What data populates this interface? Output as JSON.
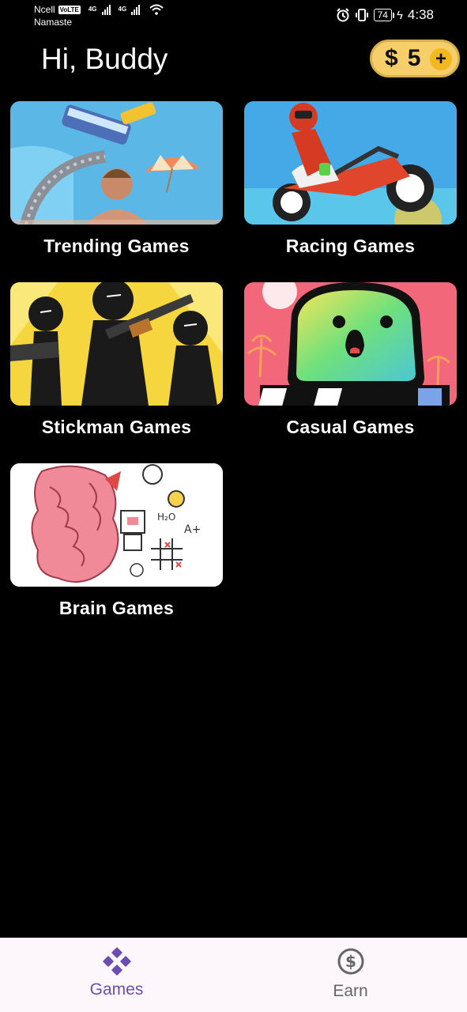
{
  "status_bar": {
    "carrier": "Ncell",
    "volte_badge": "VoLTE",
    "sim2_name": "Namaste",
    "network_1": "4G",
    "network_2": "4G",
    "battery": "74",
    "time": "4:38"
  },
  "header": {
    "greeting": "Hi, Buddy",
    "coin_symbol": "$",
    "coin_count": "5",
    "add_coins_symbol": "+"
  },
  "categories": [
    {
      "label": "Trending Games",
      "icon": "trending-thumbnail"
    },
    {
      "label": "Racing Games",
      "icon": "racing-thumbnail"
    },
    {
      "label": "Stickman Games",
      "icon": "stickman-thumbnail"
    },
    {
      "label": "Casual Games",
      "icon": "casual-thumbnail"
    },
    {
      "label": "Brain Games",
      "icon": "brain-thumbnail"
    }
  ],
  "bottom_nav": {
    "items": [
      {
        "label": "Games",
        "icon": "gamepad-icon",
        "active": true,
        "color": "#6a4fb0"
      },
      {
        "label": "Earn",
        "icon": "dollar-circle-icon",
        "active": false,
        "color": "#666666"
      }
    ]
  },
  "colors": {
    "background": "#000000",
    "coin_pill": "#f7cf6a",
    "nav_background": "#fdf6fb",
    "accent": "#6a4fb0"
  }
}
